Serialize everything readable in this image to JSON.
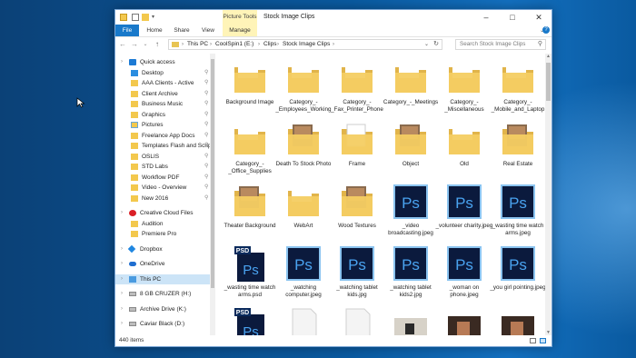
{
  "window": {
    "context_tab": "Picture Tools",
    "title": "Stock Image Clips",
    "minimize": "–",
    "maximize": "□",
    "close": "✕"
  },
  "ribbon": {
    "tabs": [
      "File",
      "Home",
      "Share",
      "View",
      "Manage"
    ],
    "help": "?"
  },
  "address": {
    "crumbs": [
      "This PC",
      "CoolSpin1 (E:)",
      "Clips",
      "Stock Image Clips"
    ],
    "search_placeholder": "Search Stock Image Clips"
  },
  "sidebar": {
    "items": [
      {
        "label": "Quick access",
        "icon": "star-icon",
        "level": 0,
        "pinned": false,
        "expand": true
      },
      {
        "label": "Desktop",
        "icon": "desktop-icon",
        "level": 1,
        "pinned": true
      },
      {
        "label": "AAA Clients - Active",
        "icon": "folder-icon",
        "level": 1,
        "pinned": true
      },
      {
        "label": "Client Archive",
        "icon": "folder-icon",
        "level": 1,
        "pinned": true
      },
      {
        "label": "Business Music",
        "icon": "folder-icon",
        "level": 1,
        "pinned": true
      },
      {
        "label": "Graphics",
        "icon": "folder-icon",
        "level": 1,
        "pinned": true
      },
      {
        "label": "Pictures",
        "icon": "pictures-icon",
        "level": 1,
        "pinned": true
      },
      {
        "label": "Freelance App Docs",
        "icon": "folder-icon",
        "level": 1,
        "pinned": true
      },
      {
        "label": "Templates Flash and Script",
        "icon": "folder-icon",
        "level": 1,
        "pinned": true
      },
      {
        "label": "OSLIS",
        "icon": "folder-icon",
        "level": 1,
        "pinned": true
      },
      {
        "label": "STD Labs",
        "icon": "folder-icon",
        "level": 1,
        "pinned": true
      },
      {
        "label": "Workflow PDF",
        "icon": "folder-icon",
        "level": 1,
        "pinned": true
      },
      {
        "label": "Video - Overview",
        "icon": "folder-icon",
        "level": 1,
        "pinned": true
      },
      {
        "label": "New 2016",
        "icon": "folder-icon",
        "level": 1,
        "pinned": true
      },
      {
        "label": "",
        "icon": "",
        "level": 0,
        "gap": true
      },
      {
        "label": "Creative Cloud Files",
        "icon": "creative-cloud-icon",
        "level": 0,
        "expand": true
      },
      {
        "label": "Audition",
        "icon": "folder-icon",
        "level": 1
      },
      {
        "label": "Premiere Pro",
        "icon": "folder-icon",
        "level": 1
      },
      {
        "label": "",
        "icon": "",
        "level": 0,
        "gap": true
      },
      {
        "label": "Dropbox",
        "icon": "dropbox-icon",
        "level": 0,
        "expand": true
      },
      {
        "label": "",
        "icon": "",
        "level": 0,
        "gap": true
      },
      {
        "label": "OneDrive",
        "icon": "onedrive-icon",
        "level": 0,
        "expand": true
      },
      {
        "label": "",
        "icon": "",
        "level": 0,
        "gap": true
      },
      {
        "label": "This PC",
        "icon": "computer-icon",
        "level": 0,
        "expand": true,
        "selected": true
      },
      {
        "label": "",
        "icon": "",
        "level": 0,
        "gap": true
      },
      {
        "label": "8 GB CRUZER (H:)",
        "icon": "drive-icon",
        "level": 0,
        "expand": true
      },
      {
        "label": "",
        "icon": "",
        "level": 0,
        "gap": true
      },
      {
        "label": "Archive Drive (K:)",
        "icon": "drive-icon",
        "level": 0,
        "expand": true
      },
      {
        "label": "",
        "icon": "",
        "level": 0,
        "gap": true
      },
      {
        "label": "Caviar Black (D:)",
        "icon": "drive-icon",
        "level": 0,
        "expand": true
      }
    ]
  },
  "files": [
    {
      "name": "Background Image",
      "type": "folder"
    },
    {
      "name": "Category_-_Employees_Working",
      "type": "folder"
    },
    {
      "name": "Category_-_Fax_Printer_Phone",
      "type": "folder"
    },
    {
      "name": "Category_-_Meetings",
      "type": "folder"
    },
    {
      "name": "Category_-_Miscellaneous",
      "type": "folder"
    },
    {
      "name": "Category_-_Mobile_and_Laptop",
      "type": "folder"
    },
    {
      "name": "Category_-_Office_Supplies",
      "type": "folder"
    },
    {
      "name": "Death To Stock Photo",
      "type": "folder-photo"
    },
    {
      "name": "Frame",
      "type": "folder-doc"
    },
    {
      "name": "Object",
      "type": "folder-photo"
    },
    {
      "name": "Old",
      "type": "folder"
    },
    {
      "name": "Real Estate",
      "type": "folder-photo"
    },
    {
      "name": "Theater Background",
      "type": "folder-photo"
    },
    {
      "name": "WebArt",
      "type": "folder"
    },
    {
      "name": "Wood Textures",
      "type": "folder-photo"
    },
    {
      "name": "_video broadcasting.jpeg",
      "type": "ps"
    },
    {
      "name": "_volunteer charity.jpeg",
      "type": "ps"
    },
    {
      "name": "_wasting time watch arms.jpeg",
      "type": "ps"
    },
    {
      "name": "_wasting time watch arms.psd",
      "type": "psd"
    },
    {
      "name": "_watching computer.jpeg",
      "type": "ps"
    },
    {
      "name": "_watching tablet kids.jpg",
      "type": "ps"
    },
    {
      "name": "_watching tablet kids2.jpg",
      "type": "ps"
    },
    {
      "name": "_woman on phone.jpeg",
      "type": "ps"
    },
    {
      "name": "_you girl pointing.jpeg",
      "type": "ps"
    },
    {
      "name": "",
      "type": "psd"
    },
    {
      "name": "",
      "type": "blank"
    },
    {
      "name": "",
      "type": "blank"
    },
    {
      "name": "",
      "type": "photo"
    },
    {
      "name": "",
      "type": "photo-dark"
    },
    {
      "name": "",
      "type": "photo-dark"
    }
  ],
  "status": {
    "count": "440 items"
  },
  "colors": {
    "ps_bg": "#0b1a3d",
    "ps_text": "#4aa3f0",
    "folder": "#f4cd62",
    "accent": "#1979ca"
  }
}
